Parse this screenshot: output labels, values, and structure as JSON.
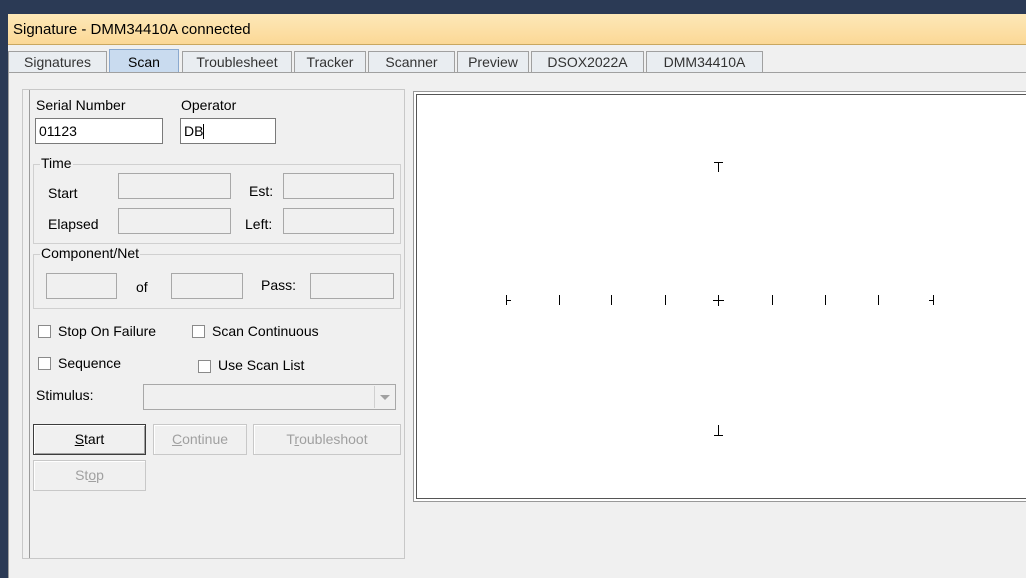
{
  "window": {
    "title": "Signature - DMM34410A connected"
  },
  "tabs": [
    {
      "label": "Signatures",
      "active": false
    },
    {
      "label": "Scan",
      "active": true
    },
    {
      "label": "Troublesheet",
      "active": false
    },
    {
      "label": "Tracker",
      "active": false
    },
    {
      "label": "Scanner",
      "active": false
    },
    {
      "label": "Preview",
      "active": false
    },
    {
      "label": "DSOX2022A",
      "active": false
    },
    {
      "label": "DMM34410A",
      "active": false
    }
  ],
  "form": {
    "serial_label": "Serial Number",
    "serial_value": "01123",
    "operator_label": "Operator",
    "operator_value": "DB",
    "time": {
      "legend": "Time",
      "start_label": "Start",
      "start_value": "",
      "est_label": "Est:",
      "est_value": "",
      "elapsed_label": "Elapsed",
      "elapsed_value": "",
      "left_label": "Left:",
      "left_value": ""
    },
    "component": {
      "legend": "Component/Net",
      "current_value": "",
      "of_label": "of",
      "total_value": "",
      "pass_label": "Pass:",
      "pass_value": ""
    },
    "options": {
      "stop_on_failure": {
        "label": "Stop On Failure",
        "checked": false
      },
      "scan_continuous": {
        "label": "Scan Continuous",
        "checked": false
      },
      "sequence": {
        "label": "Sequence",
        "checked": false
      },
      "use_scan_list": {
        "label": "Use Scan List",
        "checked": false
      }
    },
    "stimulus_label": "Stimulus:",
    "stimulus_value": "",
    "buttons": {
      "start_pre": "",
      "start_accel": "S",
      "start_post": "tart",
      "continue_pre": "",
      "continue_accel": "C",
      "continue_post": "ontinue",
      "troubleshoot_pre": "T",
      "troubleshoot_accel": "r",
      "troubleshoot_post": "oubleshoot",
      "stop_pre": "St",
      "stop_accel": "o",
      "stop_post": "p"
    }
  },
  "colors": {
    "title_bar": "#fbd896",
    "active_tab": "#c9dbef",
    "disabled_text": "#a0a0a0"
  }
}
